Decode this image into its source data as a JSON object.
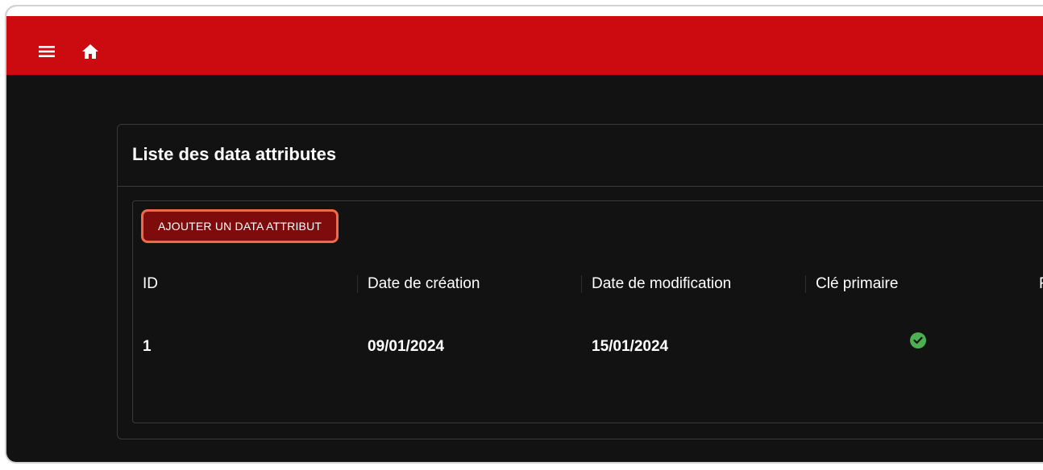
{
  "appbar": {
    "menu_icon": "menu-icon",
    "home_icon": "home-icon",
    "color": "#cc0b11"
  },
  "card": {
    "title": "Liste des data attributes",
    "add_button_label": "AJOUTER UN DATA ATTRIBUT"
  },
  "table": {
    "columns": [
      "ID",
      "Date de création",
      "Date de modification",
      "Clé primaire",
      "F"
    ],
    "rows": [
      {
        "id": "1",
        "date_creation": "09/01/2024",
        "date_modification": "15/01/2024",
        "cle_primaire": true,
        "cle_primaire_icon": "check-circle-icon"
      }
    ]
  },
  "colors": {
    "background": "#121212",
    "button_fill": "#7e0c0c",
    "button_border": "#ef6a48",
    "check": "#4caf50"
  }
}
